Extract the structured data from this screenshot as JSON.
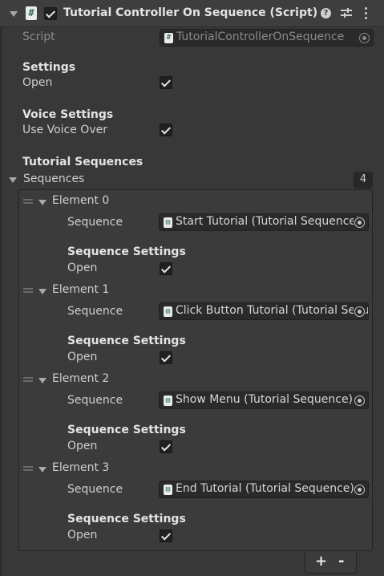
{
  "header": {
    "title": "Tutorial Controller On Sequence (Script)",
    "enabled": true,
    "icons": [
      "foldout-triangle",
      "script-icon",
      "help-icon",
      "preset-icon",
      "kebab-menu-icon"
    ]
  },
  "script_row": {
    "label": "Script",
    "value": "TutorialControllerOnSequence"
  },
  "settings": {
    "heading": "Settings",
    "open_label": "Open",
    "open_checked": true
  },
  "voice_settings": {
    "heading": "Voice Settings",
    "use_voice_over_label": "Use Voice Over",
    "use_voice_over_checked": true
  },
  "tutorial_sequences": {
    "heading": "Tutorial Sequences",
    "list_label": "Sequences",
    "count": "4",
    "elements": [
      {
        "label": "Element 0",
        "sequence_label": "Sequence",
        "sequence_value": "Start Tutorial (Tutorial Sequence)",
        "settings_heading": "Sequence Settings",
        "open_label": "Open",
        "open_checked": true
      },
      {
        "label": "Element 1",
        "sequence_label": "Sequence",
        "sequence_value": "Click Button Tutorial (Tutorial Sequence)",
        "settings_heading": "Sequence Settings",
        "open_label": "Open",
        "open_checked": true
      },
      {
        "label": "Element 2",
        "sequence_label": "Sequence",
        "sequence_value": "Show Menu (Tutorial Sequence)",
        "settings_heading": "Sequence Settings",
        "open_label": "Open",
        "open_checked": true
      },
      {
        "label": "Element 3",
        "sequence_label": "Sequence",
        "sequence_value": "End Tutorial  (Tutorial Sequence)",
        "settings_heading": "Sequence Settings",
        "open_label": "Open",
        "open_checked": true
      }
    ],
    "add_label": "+",
    "remove_label": "-"
  }
}
